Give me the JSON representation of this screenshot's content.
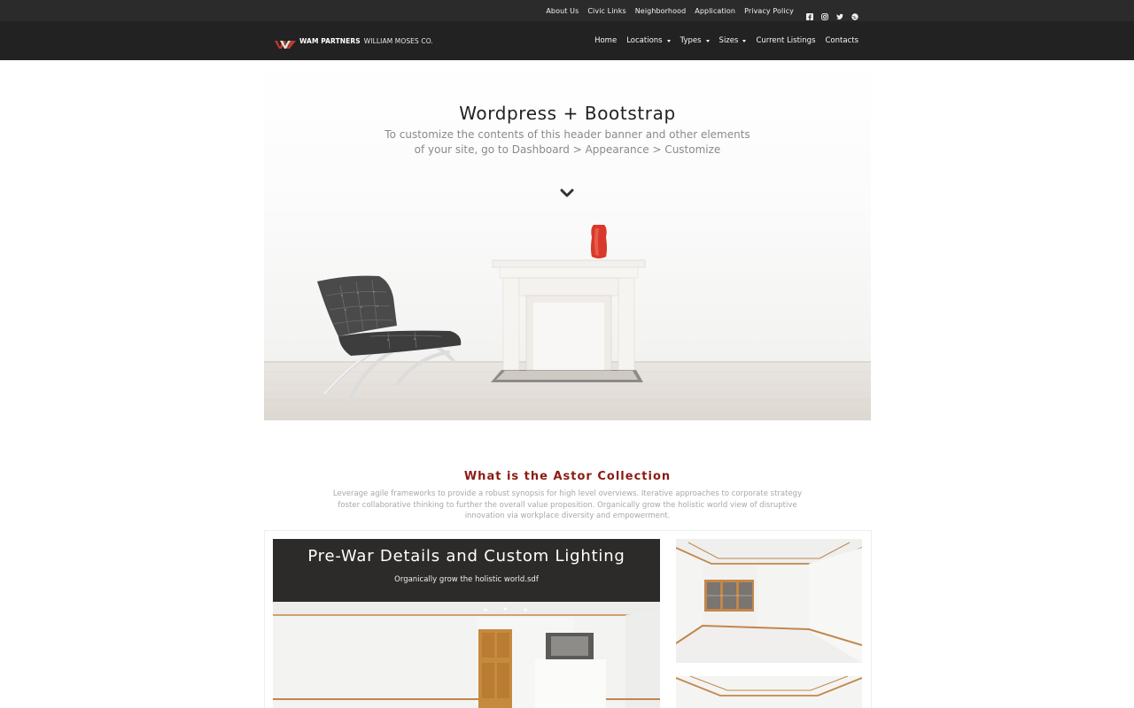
{
  "topbar": {
    "links": [
      "About Us",
      "Civic Links",
      "Neighborhood",
      "Application",
      "Privacy Policy"
    ],
    "social_icons": [
      "facebook-icon",
      "instagram-icon",
      "twitter-icon",
      "globe-icon"
    ]
  },
  "brand": {
    "bold": "WAM PARTNERS",
    "thin": "WILLIAM MOSES CO."
  },
  "nav": {
    "items": [
      {
        "label": "Home",
        "dropdown": false
      },
      {
        "label": "Locations",
        "dropdown": true
      },
      {
        "label": "Types",
        "dropdown": true
      },
      {
        "label": "Sizes",
        "dropdown": true
      },
      {
        "label": "Current Listings",
        "dropdown": false
      },
      {
        "label": "Contacts",
        "dropdown": false
      }
    ]
  },
  "hero": {
    "title": "Wordpress + Bootstrap",
    "subtitle": "To customize the contents of this header banner and other elements of your site, go to Dashboard > Appearance > Customize"
  },
  "section": {
    "title": "What is the Astor Collection",
    "description": "Leverage agile frameworks to provide a robust synopsis for high level overviews. Iterative approaches to corporate strategy foster collaborative thinking to further the overall value proposition. Organically grow the holistic world view of disruptive innovation via workplace diversity and empowerment."
  },
  "feature": {
    "title": "Pre-War Details and Custom Lighting",
    "subtitle": "Organically grow the holistic world.sdf"
  },
  "colors": {
    "topbar_bg": "#2b2b2b",
    "navbar_bg": "#222222",
    "accent": "#8b1c14",
    "logo_red": "#c0392b"
  }
}
